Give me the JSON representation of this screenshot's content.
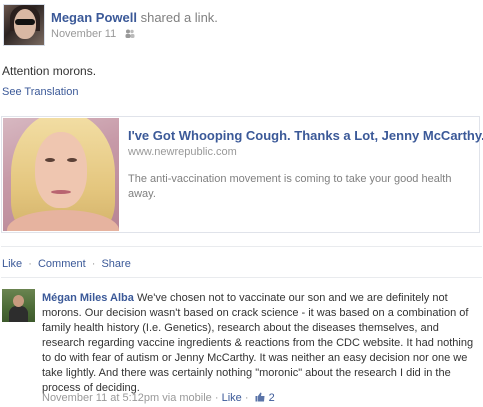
{
  "post": {
    "poster_name": "Megan Powell",
    "shared_text": "shared a link.",
    "date": "November 11",
    "audience_icon": "friends-icon",
    "message": "Attention morons.",
    "see_translation": "See Translation"
  },
  "link": {
    "title": "I've Got Whooping Cough. Thanks a Lot, Jenny McCarthy.",
    "domain": "www.newrepublic.com",
    "description": "The anti-vaccination movement is coming to take your good health away."
  },
  "actions": {
    "like": "Like",
    "comment": "Comment",
    "share": "Share",
    "separator": "·"
  },
  "comment": {
    "author": "Mégan Miles Alba",
    "text": "We've chosen not to vaccinate our son and we are definitely not morons. Our decision wasn't based on crack science - it was based on a combination of family health history (I.e. Genetics), research about the diseases themselves, and research regarding vaccine ingredients & reactions from the CDC website. It had nothing to do with fear of autism or Jenny McCarthy. It was neither an easy decision nor one we take lightly. And there was certainly nothing \"moronic\" about the research I did in the process of deciding.",
    "timestamp": "November 11 at 5:12pm via mobile",
    "separator": "·",
    "like": "Like",
    "like_count": "2",
    "like_icon": "thumbs-up-icon"
  },
  "colors": {
    "link_blue": "#3b5998",
    "meta_gray": "#999999",
    "divider": "#e9ebee"
  }
}
